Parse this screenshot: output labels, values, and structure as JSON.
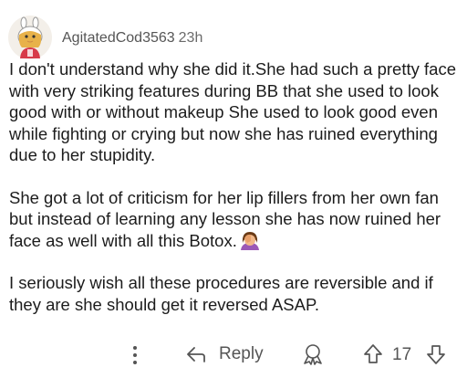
{
  "comment": {
    "username": "AgitatedCod3563",
    "age": "23h",
    "paragraphs": [
      "I don't understand why she did it.She had such a pretty face with very striking features during BB that she used to look good with or without makeup She used to look good even while fighting or crying but now she has ruined everything due to her stupidity.",
      "She got a lot of criticism for her lip fillers from her own fan but instead of learning any lesson she has now ruined her face as well with all this Botox.",
      "I seriously wish all these procedures are reversible and if they are she should get it reversed ASAP."
    ],
    "emoji": "facepalm-emoji"
  },
  "actions": {
    "reply_label": "Reply",
    "vote_count": "17",
    "icons": [
      "more-icon",
      "reply-icon",
      "award-icon",
      "upvote-icon",
      "downvote-icon"
    ]
  },
  "colors": {
    "text": "#1c1c1c",
    "meta": "#555555",
    "emoji_hair": "#6b3b16",
    "emoji_shirt": "#9b59b6"
  }
}
